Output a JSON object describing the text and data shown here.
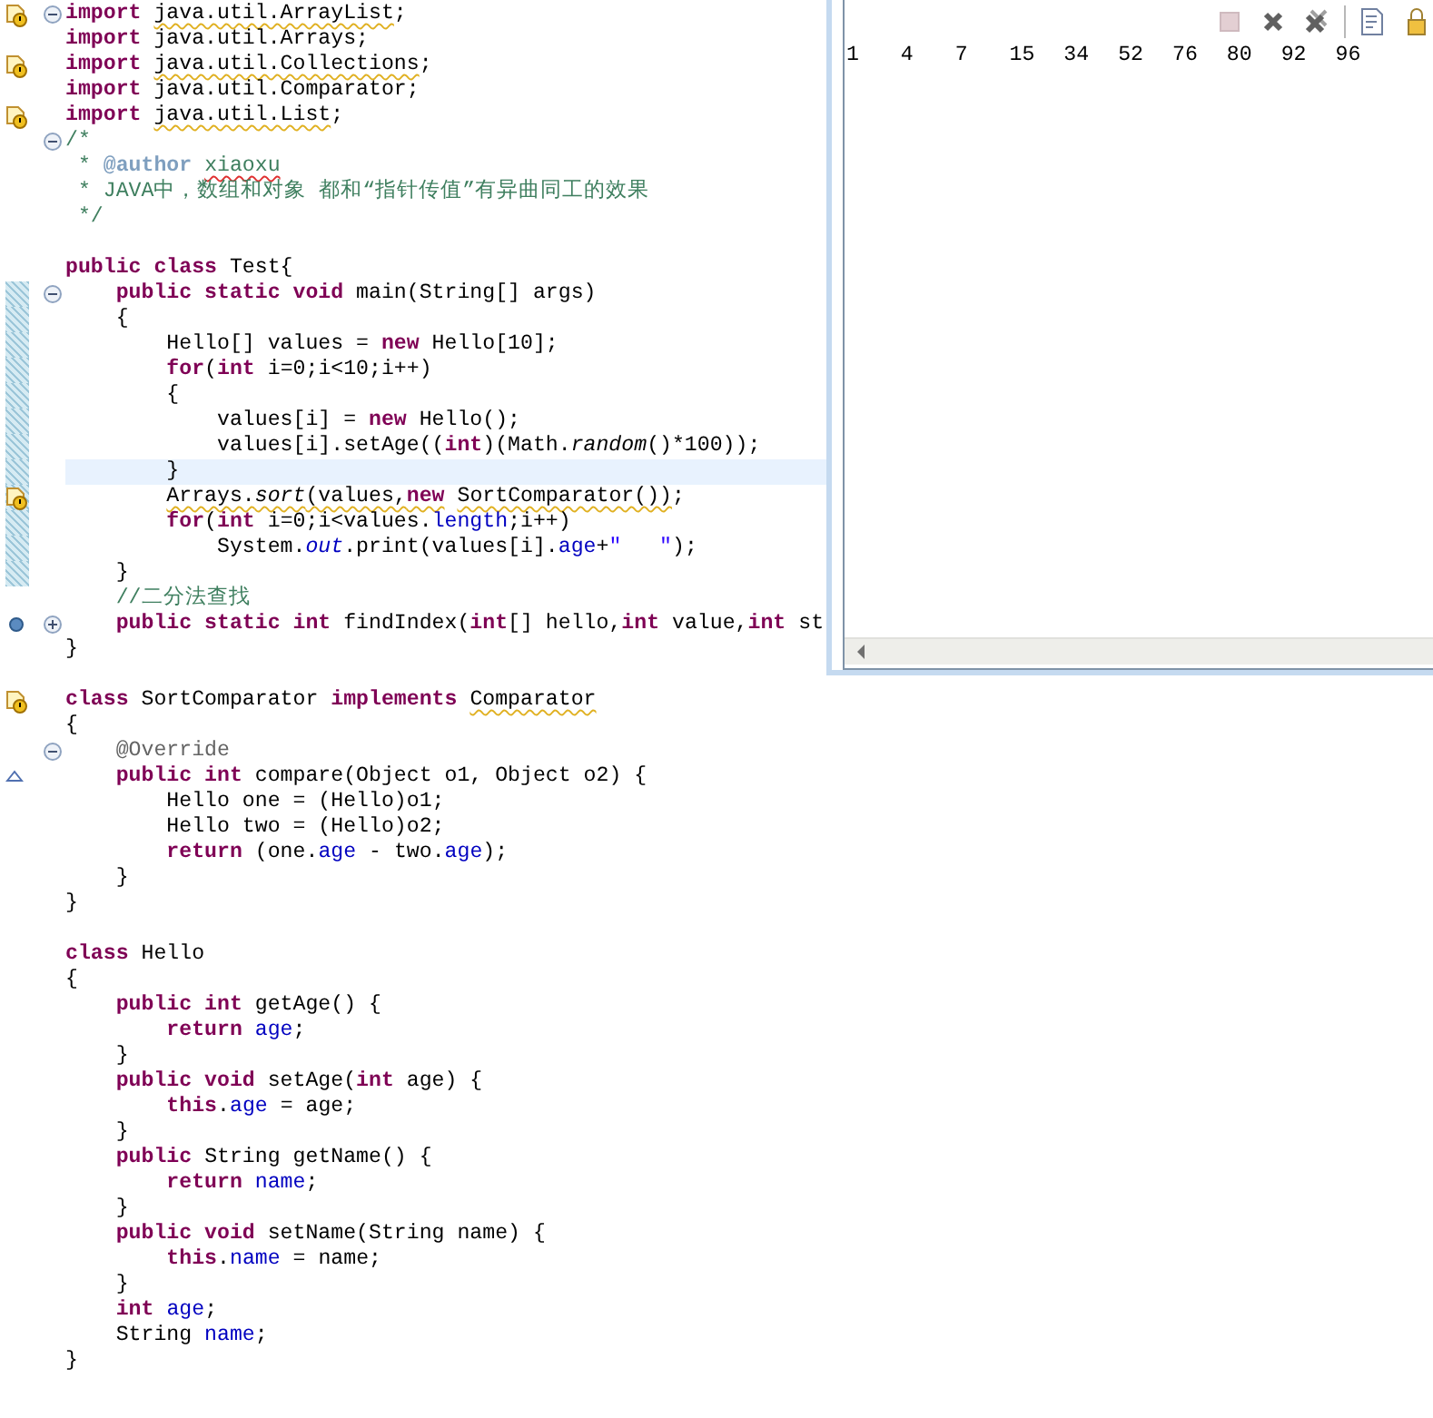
{
  "editor": {
    "lines": [
      {
        "warning": true,
        "foldable": true,
        "expanded": true,
        "tokens": [
          {
            "text": "import",
            "kind": "kw"
          },
          {
            "text": " java.util.ArrayList",
            "warning": true
          },
          {
            "text": ";"
          }
        ]
      },
      {
        "tokens": [
          {
            "text": "import",
            "kind": "kw"
          },
          {
            "text": " java.util.Arrays;"
          }
        ]
      },
      {
        "warning": true,
        "tokens": [
          {
            "text": "import",
            "kind": "kw"
          },
          {
            "text": " java.util.Collections",
            "warning": true
          },
          {
            "text": ";"
          }
        ]
      },
      {
        "tokens": [
          {
            "text": "import",
            "kind": "kw"
          },
          {
            "text": " java.util.Comparator;"
          }
        ]
      },
      {
        "warning": true,
        "tokens": [
          {
            "text": "import",
            "kind": "kw"
          },
          {
            "text": " java.util.List",
            "warning": true
          },
          {
            "text": ";"
          }
        ]
      },
      {
        "foldable": true,
        "expanded": true,
        "tokens": [
          {
            "text": "/*",
            "kind": "comment"
          }
        ]
      },
      {
        "tokens": [
          {
            "text": " * ",
            "kind": "comment"
          },
          {
            "text": "@author",
            "kind": "tag"
          },
          {
            "text": " xiaoxu",
            "kind": "comment",
            "misspelled": true
          }
        ]
      },
      {
        "tokens": [
          {
            "text": " * JAVA中，数组和对象 都和“指针传值”有异曲同工的效果",
            "kind": "comment"
          }
        ]
      },
      {
        "tokens": [
          {
            "text": " */",
            "kind": "comment"
          }
        ]
      },
      {
        "blank": true
      },
      {
        "tokens": [
          {
            "text": "public class",
            "kind": "kw"
          },
          {
            "text": " Test{"
          }
        ]
      },
      {
        "foldable": true,
        "expanded": true,
        "changed": true,
        "tokens": [
          {
            "text": "    public static void",
            "kind": "kw"
          },
          {
            "text": " main(String[] args)"
          }
        ]
      },
      {
        "changed": true,
        "tokens": [
          {
            "text": "    {"
          }
        ]
      },
      {
        "changed": true,
        "tokens": [
          {
            "text": "        Hello[] values = "
          },
          {
            "text": "new",
            "kind": "kw"
          },
          {
            "text": " Hello[10];"
          }
        ]
      },
      {
        "changed": true,
        "tokens": [
          {
            "text": "        for",
            "kind": "kw"
          },
          {
            "text": "("
          },
          {
            "text": "int",
            "kind": "kw"
          },
          {
            "text": " i=0;i<10;i++)"
          }
        ]
      },
      {
        "changed": true,
        "tokens": [
          {
            "text": "        {"
          }
        ]
      },
      {
        "changed": true,
        "tokens": [
          {
            "text": "            values[i] = "
          },
          {
            "text": "new",
            "kind": "kw"
          },
          {
            "text": " Hello();"
          }
        ]
      },
      {
        "changed": true,
        "tokens": [
          {
            "text": "            values[i].setAge(("
          },
          {
            "text": "int",
            "kind": "kw"
          },
          {
            "text": ")(Math."
          },
          {
            "text": "random",
            "kind": "static"
          },
          {
            "text": "()*100));"
          }
        ]
      },
      {
        "changed": true,
        "current": true,
        "tokens": [
          {
            "text": "        }"
          }
        ]
      },
      {
        "changed": true,
        "warning": true,
        "tokens": [
          {
            "text": "        Arrays.",
            "warning": true
          },
          {
            "text": "sort",
            "kind": "static",
            "warning": true
          },
          {
            "text": "(values,",
            "warning": true
          },
          {
            "text": "new",
            "kind": "kw",
            "warning": true
          },
          {
            "text": " SortComparator())",
            "warning": true
          },
          {
            "text": ";"
          }
        ]
      },
      {
        "changed": true,
        "tokens": [
          {
            "text": "        for",
            "kind": "kw"
          },
          {
            "text": "("
          },
          {
            "text": "int",
            "kind": "kw"
          },
          {
            "text": " i=0;i<values."
          },
          {
            "text": "length",
            "kind": "field"
          },
          {
            "text": ";i++)"
          }
        ]
      },
      {
        "changed": true,
        "tokens": [
          {
            "text": "            System."
          },
          {
            "text": "out",
            "kind": "staticfield"
          },
          {
            "text": ".print(values[i]."
          },
          {
            "text": "age",
            "kind": "field"
          },
          {
            "text": "+"
          },
          {
            "text": "\"   \"",
            "kind": "string"
          },
          {
            "text": ");"
          }
        ]
      },
      {
        "changed": true,
        "tokens": [
          {
            "text": "    }"
          }
        ]
      },
      {
        "tokens": [
          {
            "text": "    //二分法查找",
            "kind": "comment"
          }
        ]
      },
      {
        "breakpoint": true,
        "foldable": true,
        "expanded": false,
        "tokens": [
          {
            "text": "    public static int",
            "kind": "kw"
          },
          {
            "text": " findIndex("
          },
          {
            "text": "int",
            "kind": "kw"
          },
          {
            "text": "[] hello,"
          },
          {
            "text": "int",
            "kind": "kw"
          },
          {
            "text": " value,"
          },
          {
            "text": "int",
            "kind": "kw"
          },
          {
            "text": " st"
          }
        ]
      },
      {
        "tokens": [
          {
            "text": "}"
          }
        ]
      },
      {
        "blank": true
      },
      {
        "warning": true,
        "tokens": [
          {
            "text": "class",
            "kind": "kw"
          },
          {
            "text": " SortComparator "
          },
          {
            "text": "implements",
            "kind": "kw"
          },
          {
            "text": " Comparator",
            "warning": true
          }
        ]
      },
      {
        "tokens": [
          {
            "text": "{"
          }
        ]
      },
      {
        "foldable": true,
        "expanded": true,
        "tokens": [
          {
            "text": "    @Override",
            "kind": "annotation"
          }
        ]
      },
      {
        "override": true,
        "tokens": [
          {
            "text": "    public int",
            "kind": "kw"
          },
          {
            "text": " compare(Object o1, Object o2) {"
          }
        ]
      },
      {
        "tokens": [
          {
            "text": "        Hello one = (Hello)o1;"
          }
        ]
      },
      {
        "tokens": [
          {
            "text": "        Hello two = (Hello)o2;"
          }
        ]
      },
      {
        "tokens": [
          {
            "text": "        return",
            "kind": "kw"
          },
          {
            "text": " (one."
          },
          {
            "text": "age",
            "kind": "field"
          },
          {
            "text": " - two."
          },
          {
            "text": "age",
            "kind": "field"
          },
          {
            "text": ");"
          }
        ]
      },
      {
        "tokens": [
          {
            "text": "    }"
          }
        ]
      },
      {
        "tokens": [
          {
            "text": "}"
          }
        ]
      },
      {
        "blank": true
      },
      {
        "tokens": [
          {
            "text": "class",
            "kind": "kw"
          },
          {
            "text": " Hello"
          }
        ]
      },
      {
        "tokens": [
          {
            "text": "{"
          }
        ]
      },
      {
        "tokens": [
          {
            "text": "    public int",
            "kind": "kw"
          },
          {
            "text": " getAge() {"
          }
        ]
      },
      {
        "tokens": [
          {
            "text": "        return",
            "kind": "kw"
          },
          {
            "text": " age",
            "kind": "field"
          },
          {
            "text": ";"
          }
        ]
      },
      {
        "tokens": [
          {
            "text": "    }"
          }
        ]
      },
      {
        "tokens": [
          {
            "text": "    public void",
            "kind": "kw"
          },
          {
            "text": " setAge("
          },
          {
            "text": "int",
            "kind": "kw"
          },
          {
            "text": " age) {"
          }
        ]
      },
      {
        "tokens": [
          {
            "text": "        this",
            "kind": "kw"
          },
          {
            "text": "."
          },
          {
            "text": "age",
            "kind": "field"
          },
          {
            "text": " = age;"
          }
        ]
      },
      {
        "tokens": [
          {
            "text": "    }"
          }
        ]
      },
      {
        "tokens": [
          {
            "text": "    public",
            "kind": "kw"
          },
          {
            "text": " String getName() {"
          }
        ]
      },
      {
        "tokens": [
          {
            "text": "        return",
            "kind": "kw"
          },
          {
            "text": " name",
            "kind": "field"
          },
          {
            "text": ";"
          }
        ]
      },
      {
        "tokens": [
          {
            "text": "    }"
          }
        ]
      },
      {
        "tokens": [
          {
            "text": "    public void",
            "kind": "kw"
          },
          {
            "text": " setName(String name) {"
          }
        ]
      },
      {
        "tokens": [
          {
            "text": "        this",
            "kind": "kw"
          },
          {
            "text": "."
          },
          {
            "text": "name",
            "kind": "field"
          },
          {
            "text": " = name;"
          }
        ]
      },
      {
        "tokens": [
          {
            "text": "    }"
          }
        ]
      },
      {
        "tokens": [
          {
            "text": "    int",
            "kind": "kw"
          },
          {
            "text": " age",
            "kind": "field"
          },
          {
            "text": ";"
          }
        ]
      },
      {
        "tokens": [
          {
            "text": "    String "
          },
          {
            "text": "name",
            "kind": "field"
          },
          {
            "text": ";"
          }
        ]
      },
      {
        "tokens": [
          {
            "text": "}"
          }
        ]
      }
    ]
  },
  "console": {
    "toolbar": [
      {
        "kind": "terminate",
        "disabled": true
      },
      {
        "kind": "remove",
        "disabled": false
      },
      {
        "kind": "remove-all",
        "disabled": false
      },
      {
        "kind": "separator"
      },
      {
        "kind": "doc",
        "disabled": false
      },
      {
        "kind": "lock",
        "disabled": false
      }
    ],
    "output": [
      "1",
      "4",
      "7",
      "15",
      "34",
      "52",
      "76",
      "80",
      "92",
      "96"
    ]
  }
}
